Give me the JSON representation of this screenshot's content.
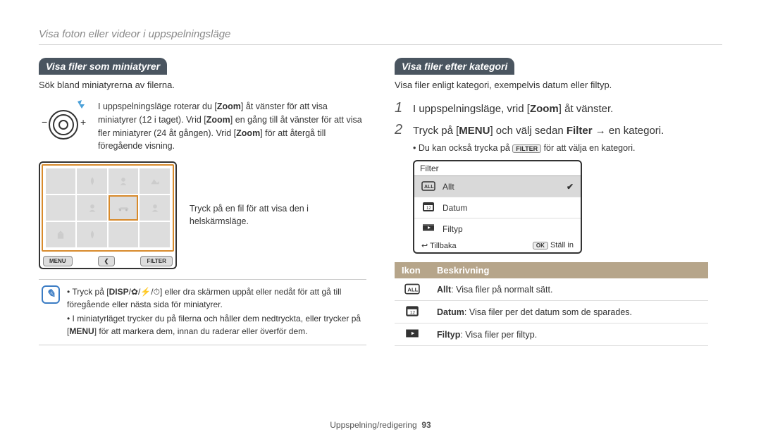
{
  "breadcrumb": "Visa foton eller videor i uppspelningsläge",
  "left": {
    "heading": "Visa filer som miniatyrer",
    "intro": "Sök bland miniatyrerna av filerna.",
    "dial_text_1": "I uppspelningsläge roterar du [",
    "dial_zoom1": "Zoom",
    "dial_text_2": "] åt vänster för att visa miniatyrer (12 i taget). Vrid [",
    "dial_zoom2": "Zoom",
    "dial_text_3": "] en gång till åt vänster för att visa fler miniatyrer (24 åt gången). Vrid [",
    "dial_zoom3": "Zoom",
    "dial_text_4": "] för att återgå till föregående visning.",
    "screen_btns": {
      "menu": "MENU",
      "share": "❮",
      "filter": "FILTER"
    },
    "callout": "Tryck på en fil för att visa den i helskärmsläge.",
    "note_b1_a": "Tryck på [",
    "note_b1_disp": "DISP",
    "note_b1_b": "] eller dra skärmen uppåt eller nedåt för att gå till föregående eller nästa sida för miniatyrer.",
    "note_b2_a": "I miniatyrläget trycker du på filerna och håller dem nedtryckta, eller trycker på [",
    "note_b2_menu": "MENU",
    "note_b2_b": "] för att markera dem, innan du raderar eller överför dem."
  },
  "right": {
    "heading": "Visa filer efter kategori",
    "intro": "Visa filer enligt kategori, exempelvis datum eller filtyp.",
    "step1_a": "I uppspelningsläge, vrid [",
    "step1_zoom": "Zoom",
    "step1_b": "] åt vänster.",
    "step2_a": "Tryck på [",
    "step2_menu": "MENU",
    "step2_b": "] och välj sedan ",
    "step2_filter": "Filter",
    "step2_c": " → en kategori.",
    "step2_sub_a": "Du kan också trycka på ",
    "step2_sub_btn": "FILTER",
    "step2_sub_b": " för att välja en kategori.",
    "filter_hdr": "Filter",
    "filter_rows": {
      "all": "Allt",
      "date": "Datum",
      "type": "Filtyp"
    },
    "icon_names": {
      "all": "all-icon",
      "date": "calendar-icon",
      "type": "filmstrip-icon"
    },
    "filter_footer": {
      "back": "Tillbaka",
      "ok": "Ställ in",
      "back_icon": "↩",
      "ok_icon": "OK"
    },
    "table": {
      "hdr_icon": "Ikon",
      "hdr_desc": "Beskrivning",
      "rows": [
        {
          "bold": "Allt",
          "rest": ": Visa filer på normalt sätt."
        },
        {
          "bold": "Datum",
          "rest": ": Visa filer per det datum som de sparades."
        },
        {
          "bold": "Filtyp",
          "rest": ": Visa filer per filtyp."
        }
      ]
    }
  },
  "footer": {
    "section": "Uppspelning/redigering",
    "page": "93"
  }
}
